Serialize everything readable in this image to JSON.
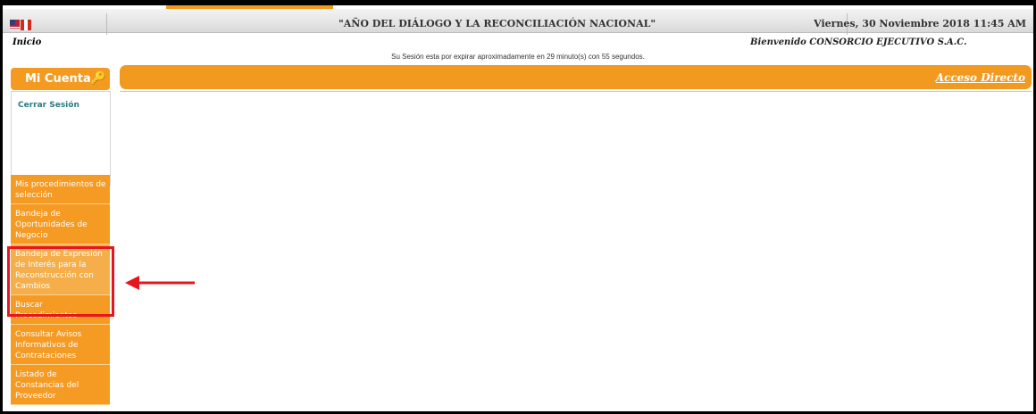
{
  "header": {
    "title": "\"AÑO DEL DIÁLOGO Y LA RECONCILIACIÓN NACIONAL\"",
    "date": "Viernes, 30 Noviembre 2018 11:45 AM",
    "flag": "flag-icon"
  },
  "breadcrumb": "Inicio",
  "welcome": "Bienvenido  CONSORCIO EJECUTIVO S.A.C.",
  "session_msg": "Su Sesión esta por expirar aproximadamente en 29 minuto(s) con 55 segundos.",
  "account": {
    "title": "Mi Cuenta",
    "icon": "key-icon",
    "logout": "Cerrar Sesión"
  },
  "menu": {
    "items": [
      {
        "label": "Mis procedimientos de selección"
      },
      {
        "label": "Bandeja de Oportunidades de Negocio"
      },
      {
        "label": "Bandeja de Expresión de Interés para la Reconstrucción con Cambios"
      },
      {
        "label": "Buscar Procedimientos"
      },
      {
        "label": "Consultar Avisos Informativos de Contrataciones"
      },
      {
        "label": "Listado de Constancias del Proveedor"
      }
    ]
  },
  "content": {
    "shortcut": "Acceso Directo"
  },
  "colors": {
    "accent": "#f29a1f",
    "annotation": "#e8151c"
  }
}
